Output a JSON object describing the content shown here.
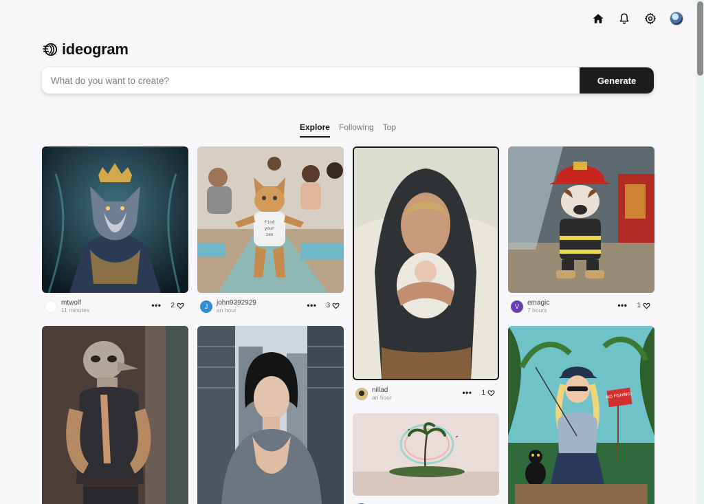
{
  "app": {
    "name": "ideogram"
  },
  "nav": {
    "icons": [
      "home-icon",
      "bell-icon",
      "gear-icon",
      "avatar"
    ]
  },
  "search": {
    "placeholder": "What do you want to create?",
    "value": "",
    "button_label": "Generate"
  },
  "tabs": [
    {
      "label": "Explore",
      "active": true
    },
    {
      "label": "Following",
      "active": false
    },
    {
      "label": "Top",
      "active": false
    }
  ],
  "cards": [
    {
      "user": "mtwolf",
      "time": "11 minutes",
      "likes": "2",
      "avatar_letter": "",
      "avatar_color": "#ffffff"
    },
    {
      "user": "john9392929",
      "time": "an hour",
      "likes": "3",
      "avatar_letter": "J",
      "avatar_color": "#2f8fd6"
    },
    {
      "user": "nillad",
      "time": "an hour",
      "likes": "1",
      "avatar_letter": "",
      "avatar_color": "#b58c4a"
    },
    {
      "user": "emagic",
      "time": "7 hours",
      "likes": "1",
      "avatar_letter": "V",
      "avatar_color": "#6a3fb5"
    }
  ],
  "cat_shirt_text": "Find your zen",
  "sign_text": "NO FISHING!",
  "colors": {
    "accent": "#1d1d1f",
    "background": "#f7f7f9"
  }
}
